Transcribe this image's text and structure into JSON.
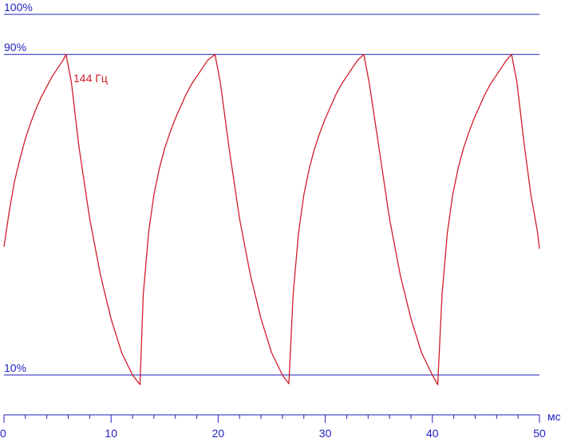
{
  "chart_data": {
    "type": "line",
    "x_unit_label": "мс",
    "xlim": [
      0,
      50
    ],
    "x_ticks": [
      "0",
      "10",
      "20",
      "30",
      "40",
      "50"
    ],
    "x_major_step": 10,
    "x_minor_step": 2,
    "ylim": [
      0,
      102
    ],
    "reference_lines": [
      {
        "label": "100%",
        "value": 100
      },
      {
        "label": "90%",
        "value": 90
      },
      {
        "label": "10%",
        "value": 10
      }
    ],
    "series": [
      {
        "name": "144 Гц",
        "color": "#d01c2a",
        "points": [
          [
            0.0,
            42
          ],
          [
            0.5,
            51
          ],
          [
            1.0,
            58.5
          ],
          [
            1.5,
            64
          ],
          [
            2.0,
            69
          ],
          [
            2.5,
            73
          ],
          [
            3.0,
            76.5
          ],
          [
            3.5,
            79.5
          ],
          [
            4.0,
            82
          ],
          [
            4.5,
            84.5
          ],
          [
            5.0,
            86.5
          ],
          [
            5.5,
            88.5
          ],
          [
            5.8,
            90
          ],
          [
            6.3,
            83
          ],
          [
            7.0,
            67
          ],
          [
            8.0,
            49
          ],
          [
            9.0,
            35
          ],
          [
            10.0,
            24
          ],
          [
            11.0,
            15.5
          ],
          [
            12.0,
            10
          ],
          [
            12.7,
            7.6
          ],
          [
            13.0,
            30
          ],
          [
            13.5,
            45.5
          ],
          [
            14.0,
            55
          ],
          [
            14.5,
            61.5
          ],
          [
            15.0,
            66.5
          ],
          [
            15.5,
            70.5
          ],
          [
            16.0,
            74
          ],
          [
            16.5,
            77
          ],
          [
            17.0,
            80
          ],
          [
            17.5,
            82.5
          ],
          [
            18.0,
            84.5
          ],
          [
            18.5,
            86.5
          ],
          [
            19.0,
            88.5
          ],
          [
            19.7,
            90
          ],
          [
            20.2,
            83
          ],
          [
            21.0,
            67
          ],
          [
            22.0,
            49
          ],
          [
            23.0,
            35
          ],
          [
            24.0,
            24
          ],
          [
            25.0,
            15.5
          ],
          [
            26.0,
            10
          ],
          [
            26.6,
            7.8
          ],
          [
            27.0,
            30
          ],
          [
            27.5,
            45.5
          ],
          [
            28.0,
            55
          ],
          [
            28.5,
            61.5
          ],
          [
            29.0,
            66.5
          ],
          [
            29.5,
            70.5
          ],
          [
            30.0,
            74
          ],
          [
            30.5,
            77
          ],
          [
            31.0,
            80
          ],
          [
            31.5,
            82.5
          ],
          [
            32.0,
            84.5
          ],
          [
            32.5,
            86.5
          ],
          [
            33.0,
            88.5
          ],
          [
            33.6,
            90
          ],
          [
            34.1,
            83
          ],
          [
            35.0,
            67
          ],
          [
            36.0,
            49
          ],
          [
            37.0,
            35
          ],
          [
            38.0,
            24
          ],
          [
            39.0,
            15.5
          ],
          [
            40.0,
            10
          ],
          [
            40.5,
            7.6
          ],
          [
            40.9,
            30
          ],
          [
            41.4,
            45.5
          ],
          [
            41.9,
            55
          ],
          [
            42.4,
            61.5
          ],
          [
            42.9,
            66.5
          ],
          [
            43.4,
            70.5
          ],
          [
            43.9,
            74
          ],
          [
            44.4,
            77
          ],
          [
            44.9,
            80
          ],
          [
            45.4,
            82.5
          ],
          [
            45.9,
            84.5
          ],
          [
            46.4,
            86.5
          ],
          [
            46.9,
            88.5
          ],
          [
            47.4,
            90
          ],
          [
            47.9,
            83
          ],
          [
            48.6,
            67
          ],
          [
            49.2,
            55
          ],
          [
            49.8,
            46
          ],
          [
            50.0,
            41.5
          ]
        ]
      }
    ]
  }
}
